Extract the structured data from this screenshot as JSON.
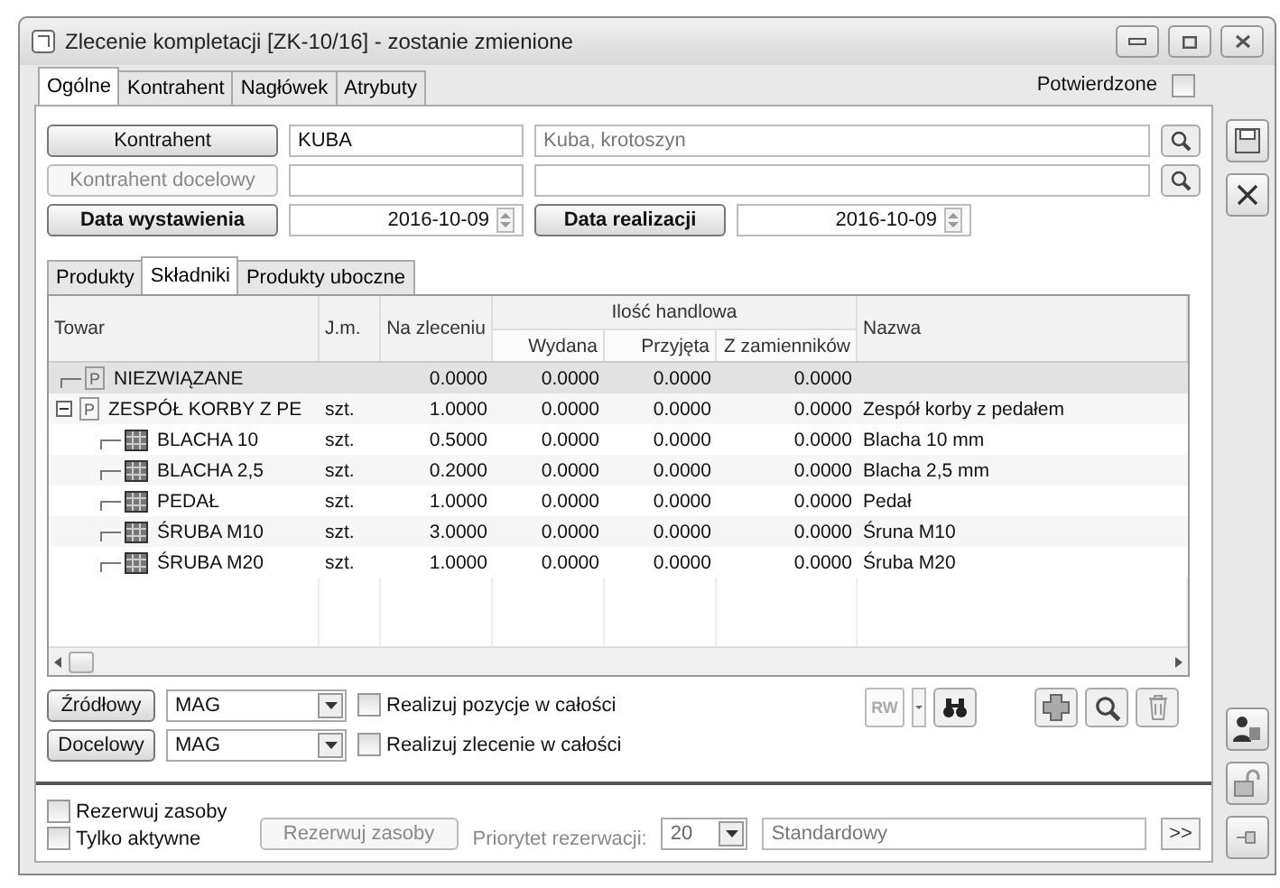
{
  "window": {
    "title": "Zlecenie kompletacji [ZK-10/16] - zostanie zmienione"
  },
  "tabs": [
    {
      "label": "Ogólne",
      "selected": true
    },
    {
      "label": "Kontrahent",
      "selected": false
    },
    {
      "label": "Nagłówek",
      "selected": false
    },
    {
      "label": "Atrybuty",
      "selected": false
    }
  ],
  "confirmed": {
    "label": "Potwierdzone",
    "checked": false
  },
  "contractor": {
    "button": "Kontrahent",
    "code": "KUBA",
    "name": "Kuba, krotoszyn"
  },
  "target_contractor": {
    "button": "Kontrahent docelowy",
    "disabled": true
  },
  "dates": [
    {
      "button": "Data wystawienia",
      "value": "2016-10-09"
    },
    {
      "button": "Data realizacji",
      "value": "2016-10-09"
    }
  ],
  "subtabs": [
    {
      "label": "Produkty",
      "selected": false
    },
    {
      "label": "Składniki",
      "selected": true
    },
    {
      "label": "Produkty uboczne",
      "selected": false
    }
  ],
  "grid": {
    "group_header": "Ilość handlowa",
    "columns": [
      "Towar",
      "J.m.",
      "Na zleceniu",
      "Wydana",
      "Przyjęta",
      "Z zamienników",
      "Nazwa"
    ],
    "rows": [
      {
        "kind": "group",
        "badge": "P",
        "towar": "NIEZWIĄZANE",
        "ordered": "0.0000",
        "issued": "0.0000",
        "received": "0.0000",
        "substitutes": "0.0000",
        "selected": true
      },
      {
        "kind": "group",
        "badge": "P",
        "towar": "ZESPÓŁ KORBY Z PE",
        "jm": "szt.",
        "ordered": "1.0000",
        "issued": "0.0000",
        "received": "0.0000",
        "substitutes": "0.0000",
        "name": "Zespół korby z pedałem",
        "selected": false,
        "expanded": true,
        "children": [
          {
            "kind": "item",
            "towar": "BLACHA 10",
            "jm": "szt.",
            "ordered": "0.5000",
            "issued": "0.0000",
            "received": "0.0000",
            "substitutes": "0.0000",
            "name": "Blacha 10 mm",
            "selected": false
          },
          {
            "kind": "item",
            "towar": "BLACHA 2,5",
            "jm": "szt.",
            "ordered": "0.2000",
            "issued": "0.0000",
            "received": "0.0000",
            "substitutes": "0.0000",
            "name": "Blacha 2,5 mm",
            "selected": false
          },
          {
            "kind": "item",
            "towar": "PEDAŁ",
            "jm": "szt.",
            "ordered": "1.0000",
            "issued": "0.0000",
            "received": "0.0000",
            "substitutes": "0.0000",
            "name": "Pedał",
            "selected": false
          },
          {
            "kind": "item",
            "towar": "ŚRUBA M10",
            "jm": "szt.",
            "ordered": "3.0000",
            "issued": "0.0000",
            "received": "0.0000",
            "substitutes": "0.0000",
            "name": "Śruna M10",
            "selected": false
          },
          {
            "kind": "item",
            "towar": "ŚRUBA M20",
            "jm": "szt.",
            "ordered": "1.0000",
            "issued": "0.0000",
            "received": "0.0000",
            "substitutes": "0.0000",
            "name": "Śruba M20",
            "selected": false
          }
        ]
      }
    ]
  },
  "warehouses": [
    {
      "button": "Źródłowy",
      "value": "MAG",
      "option": "Realizuj pozycje w całości",
      "checked": false
    },
    {
      "button": "Docelowy",
      "value": "MAG",
      "option": "Realizuj zlecenie w całości",
      "checked": false
    }
  ],
  "toolbar": {
    "rw_label": "RW"
  },
  "reservation": {
    "options": [
      {
        "label": "Rezerwuj zasoby",
        "checked": false
      },
      {
        "label": "Tylko aktywne",
        "checked": false
      }
    ],
    "button": "Rezerwuj zasoby",
    "priority_label": "Priorytet rezerwacji:",
    "priority": "20",
    "profile": "Standardowy",
    "more": ">>"
  }
}
